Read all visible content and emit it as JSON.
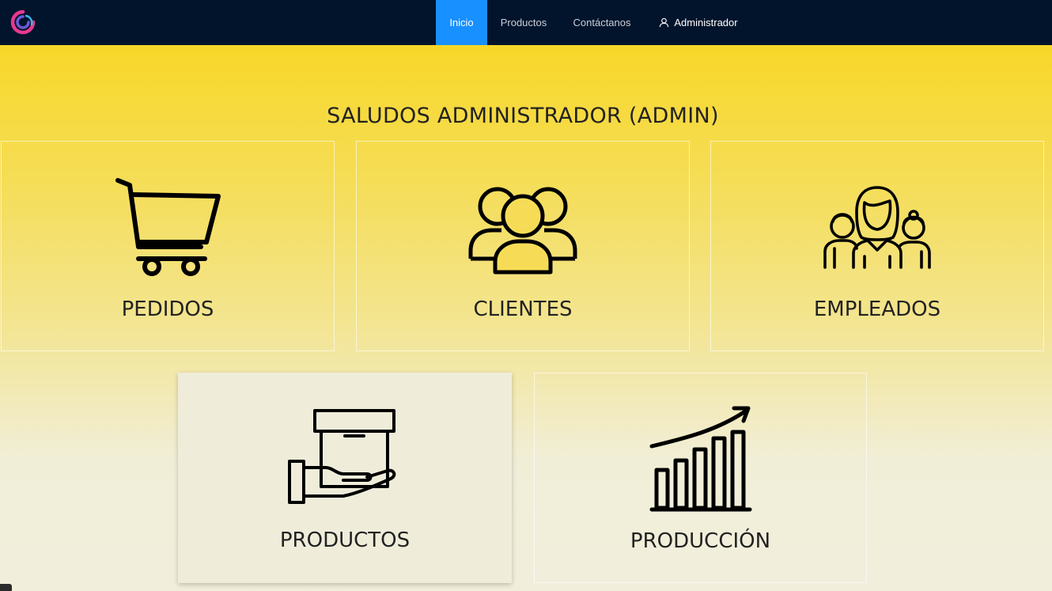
{
  "brand": {
    "logo_icon": "swirl-logo-icon",
    "colors": [
      "#e8398f",
      "#6b5bd6",
      "#3fb3e8"
    ]
  },
  "nav": {
    "items": [
      {
        "label": "Inicio",
        "active": true
      },
      {
        "label": "Productos",
        "active": false
      },
      {
        "label": "Contáctanos",
        "active": false
      }
    ],
    "user_label": "Administrador",
    "user_icon": "user-icon",
    "active_color": "#1890ff",
    "background": "#01142c"
  },
  "greeting": "SALUDOS ADMINISTRADOR (ADMIN)",
  "cards": [
    {
      "label": "PEDIDOS",
      "icon": "shopping-cart-icon"
    },
    {
      "label": "CLIENTES",
      "icon": "users-group-icon"
    },
    {
      "label": "EMPLEADOS",
      "icon": "employees-icon"
    },
    {
      "label": "PRODUCTOS",
      "icon": "box-in-hand-icon"
    },
    {
      "label": "PRODUCCIÓN",
      "icon": "growth-chart-icon"
    }
  ]
}
